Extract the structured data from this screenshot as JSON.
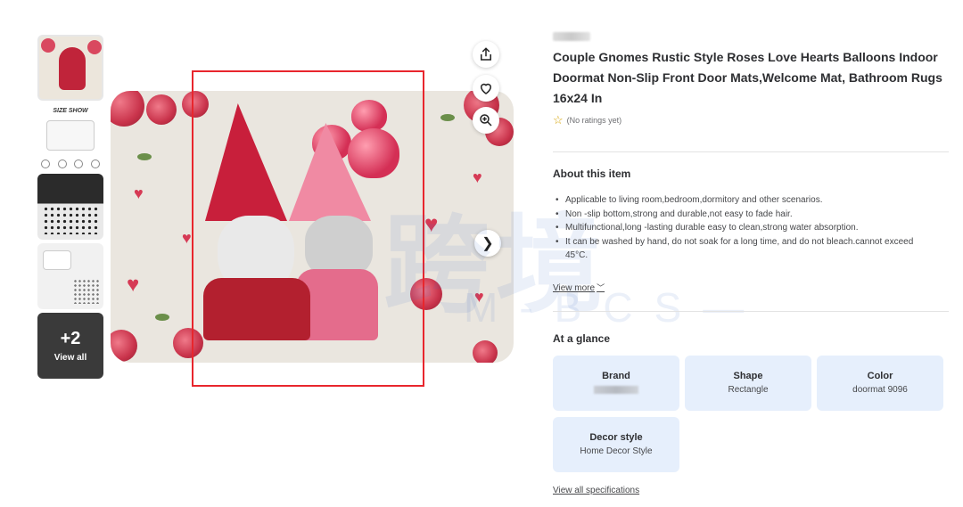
{
  "product": {
    "title": "Couple Gnomes Rustic Style Roses Love Hearts Balloons Indoor Doormat Non-Slip Front Door Mats,Welcome Mat, Bathroom Rugs 16x24 In",
    "rating_text": "(No ratings yet)"
  },
  "gallery": {
    "size_show_label": "SIZE SHOW",
    "more_count": "+2",
    "view_all_label": "View all"
  },
  "about": {
    "heading": "About this item",
    "bullets": [
      "Applicable to living room,bedroom,dormitory and other scenarios.",
      "Non -slip bottom,strong and durable,not easy to fade hair.",
      "Multifunctional,long -lasting durable easy to clean,strong water absorption.",
      "It can be washed by hand, do not soak for a long time, and do not bleach.cannot exceed 45°C."
    ],
    "view_more_label": "View more"
  },
  "glance": {
    "heading": "At a glance",
    "cards": [
      {
        "key": "Brand",
        "value": ""
      },
      {
        "key": "Shape",
        "value": "Rectangle"
      },
      {
        "key": "Color",
        "value": "doormat 9096"
      },
      {
        "key": "Decor style",
        "value": "Home Decor Style"
      }
    ],
    "view_all_specs_label": "View all specifications"
  },
  "watermark": {
    "main": "跨境",
    "sub": "M-BCS—"
  },
  "icons": {
    "share": "share-icon",
    "favorite": "heart-icon",
    "zoom": "zoom-icon",
    "next": "chevron-right-icon",
    "rating_star": "star-outline-icon"
  },
  "colors": {
    "highlight_box": "#e8262d",
    "card_bg": "#e6effc",
    "star": "#d5a200"
  }
}
